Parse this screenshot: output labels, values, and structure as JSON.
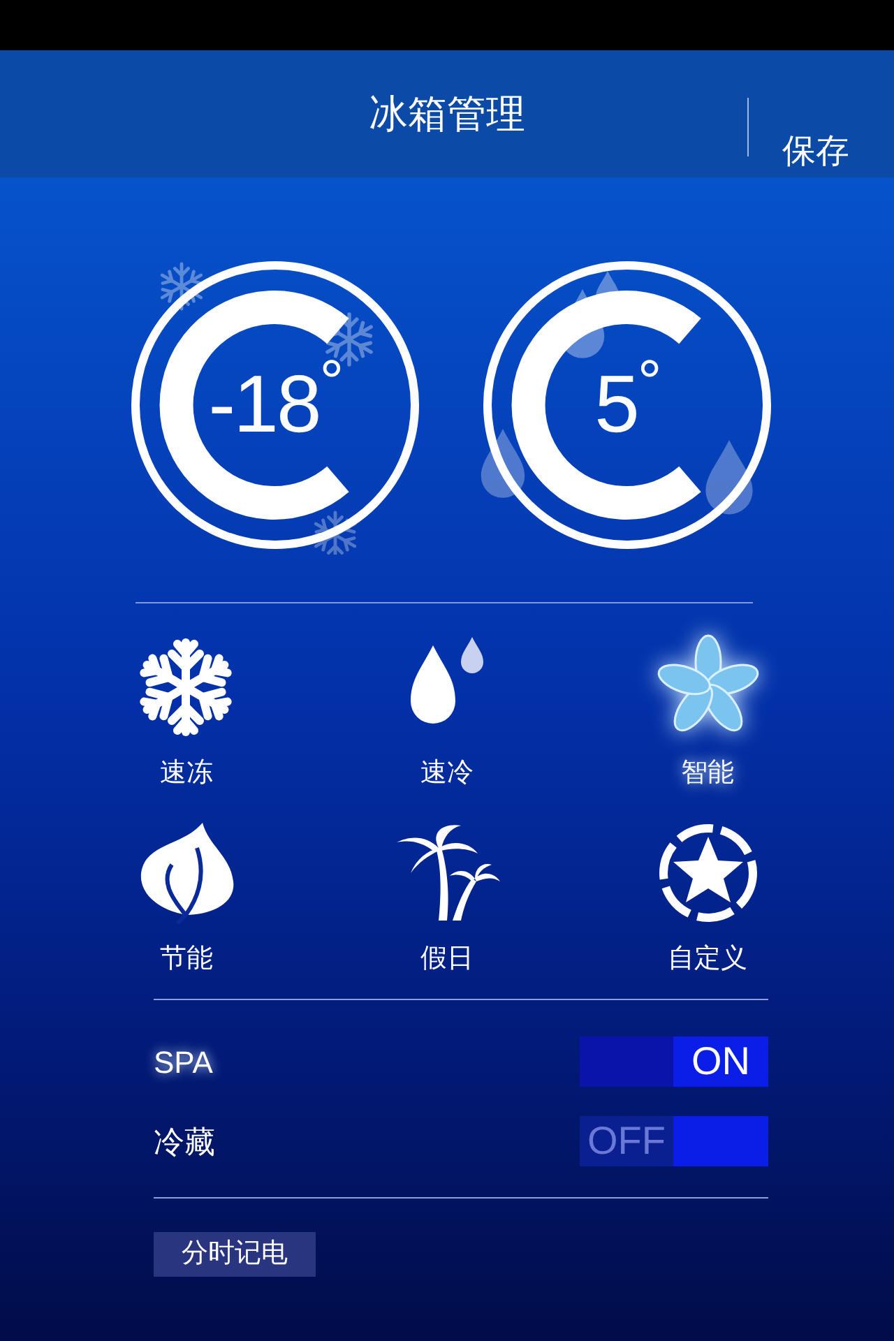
{
  "header": {
    "title": "冰箱管理",
    "action": "保存"
  },
  "dials": [
    {
      "kind": "freezer",
      "temperature": "-18$^{°}$"
    },
    {
      "kind": "fridge",
      "temperature": "5$^{°}$"
    }
  ],
  "modes": [
    {
      "kind": "snowflake",
      "label": "速冻",
      "selected": false
    },
    {
      "kind": "drops",
      "label": "速冷",
      "selected": false
    },
    {
      "kind": "flower",
      "label": "智能",
      "selected": true
    },
    {
      "kind": "leaf",
      "label": "节能",
      "selected": false
    },
    {
      "kind": "palm",
      "label": "假日",
      "selected": false
    },
    {
      "kind": "star",
      "label": "自定义",
      "selected": false
    }
  ],
  "toggles": [
    {
      "label": "SPA",
      "on": true,
      "state_text": "ON"
    },
    {
      "label": "冷藏",
      "on": false,
      "state_text": "OFF"
    }
  ],
  "footer_button": "分时记电"
}
